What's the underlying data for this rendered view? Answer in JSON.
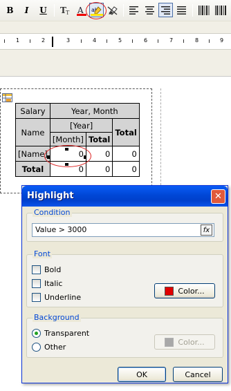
{
  "toolbar": {
    "bold_label": "B",
    "italic_label": "I",
    "underline_label": "U"
  },
  "ruler": {
    "labels": [
      "1",
      "2",
      "3",
      "4",
      "5",
      "6",
      "7",
      "8",
      "9"
    ]
  },
  "crosstab": {
    "header_salary": "Salary",
    "header_year_month": "Year, Month",
    "header_name": "Name",
    "header_year": "[Year]",
    "header_month": "[Month]",
    "header_total": "Total",
    "header_grand_total": "Total",
    "row_name": "[Name]",
    "row_total": "Total",
    "values": {
      "r1c1": "0",
      "r1c2": "0",
      "r1c3": "0",
      "r2c1": "0",
      "r2c2": "0",
      "r2c3": "0"
    }
  },
  "dialog": {
    "title": "Highlight",
    "close_label": "✕",
    "condition": {
      "group_label": "Condition",
      "expression": "Value > 3000",
      "fx_label": "fx"
    },
    "font": {
      "group_label": "Font",
      "bold": "Bold",
      "italic": "Italic",
      "underline": "Underline",
      "color_button": "Color...",
      "color": "#e00000"
    },
    "background": {
      "group_label": "Background",
      "transparent": "Transparent",
      "other": "Other",
      "color_button": "Color...",
      "selected": "Transparent"
    },
    "ok_label": "OK",
    "cancel_label": "Cancel"
  }
}
